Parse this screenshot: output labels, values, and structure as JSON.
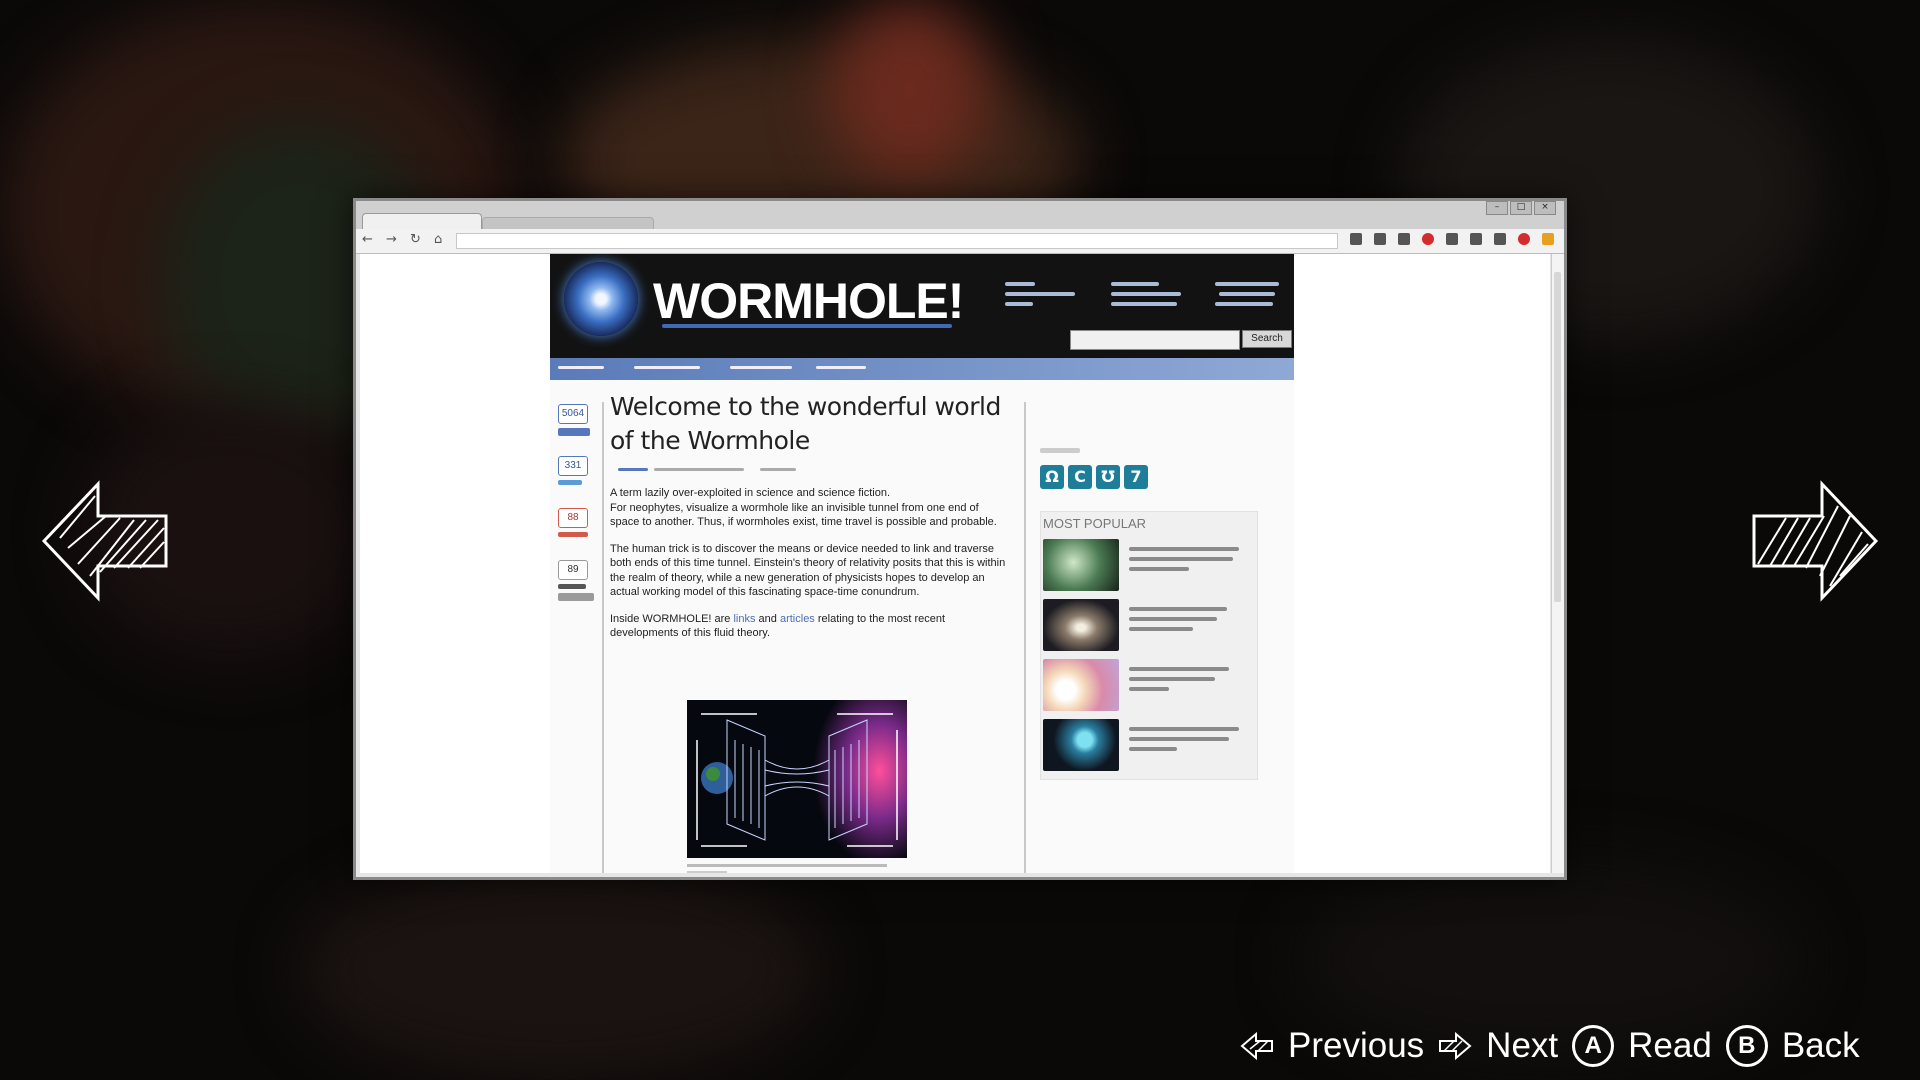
{
  "site": {
    "title": "WORMHOLE!",
    "search_button": "Search"
  },
  "shares": [
    {
      "count": "5064",
      "color": "#5577bb"
    },
    {
      "count": "331",
      "color": "#5a9bd8"
    },
    {
      "count": "88",
      "color": "#d35a4a"
    },
    {
      "count": "89",
      "color": "#888888"
    }
  ],
  "article": {
    "heading": "Welcome to the wonderful world of the Wormhole",
    "p1_a": "A term lazily over-exploited in science and science fiction.",
    "p1_b": "For neophytes, visualize a wormhole like an invisible tunnel from one end of space to another. Thus, if wormholes exist, time travel is possible and probable.",
    "p2": "The human trick is to discover the means or device needed to link and traverse both ends of this time tunnel. Einstein's theory of relativity posits that this is within the realm of theory, while a new generation of physicists hopes to develop an actual working model of this fascinating space-time conundrum.",
    "p3_pre": "Inside WORMHOLE! are ",
    "p3_link1": "links",
    "p3_mid": " and ",
    "p3_link2": "articles",
    "p3_post": " relating to the most recent developments of this fluid theory."
  },
  "sidebar": {
    "social_glyphs": [
      "Ω",
      "C",
      "Ʊ",
      "7"
    ],
    "most_popular_title": "MOST POPULAR"
  },
  "controls": {
    "previous": "Previous",
    "next": "Next",
    "read_key": "A",
    "read": "Read",
    "back_key": "B",
    "back": "Back"
  }
}
